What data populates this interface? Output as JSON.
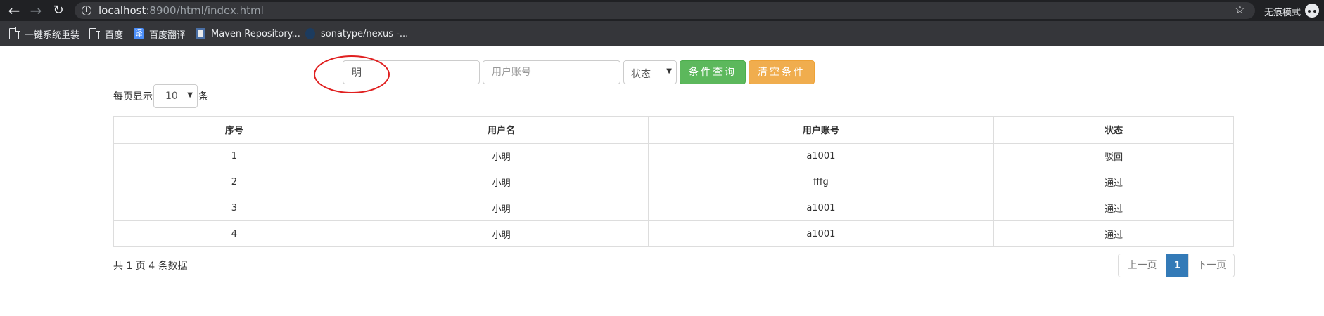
{
  "browser": {
    "url_host": "localhost",
    "url_rest": ":8900/html/index.html",
    "incognito_label": "无痕模式",
    "bookmarks": [
      {
        "label": "一键系统重装",
        "icon": "page-icon"
      },
      {
        "label": "百度",
        "icon": "page-icon"
      },
      {
        "label": "百度翻译",
        "icon": "translate-icon"
      },
      {
        "label": "Maven Repository...",
        "icon": "maven-icon"
      },
      {
        "label": "sonatype/nexus -...",
        "icon": "nexus-icon"
      }
    ]
  },
  "search": {
    "name_value": "明",
    "account_placeholder": "用户账号",
    "status_selected": "状态",
    "search_button": "条件查询",
    "clear_button": "清空条件"
  },
  "pagesize": {
    "prefix": "每页显示",
    "value": "10",
    "suffix": "条"
  },
  "table": {
    "headers": [
      "序号",
      "用户名",
      "用户账号",
      "状态"
    ],
    "rows": [
      [
        "1",
        "小明",
        "a1001",
        "驳回"
      ],
      [
        "2",
        "小明",
        "fffg",
        "通过"
      ],
      [
        "3",
        "小明",
        "a1001",
        "通过"
      ],
      [
        "4",
        "小明",
        "a1001",
        "通过"
      ]
    ]
  },
  "summary": "共 1 页 4 条数据",
  "pagination": {
    "prev": "上一页",
    "current": "1",
    "next": "下一页"
  },
  "colors": {
    "success": "#5cb85c",
    "warning": "#f0ad4e",
    "primary": "#337ab7",
    "annotation": "#e02020"
  }
}
